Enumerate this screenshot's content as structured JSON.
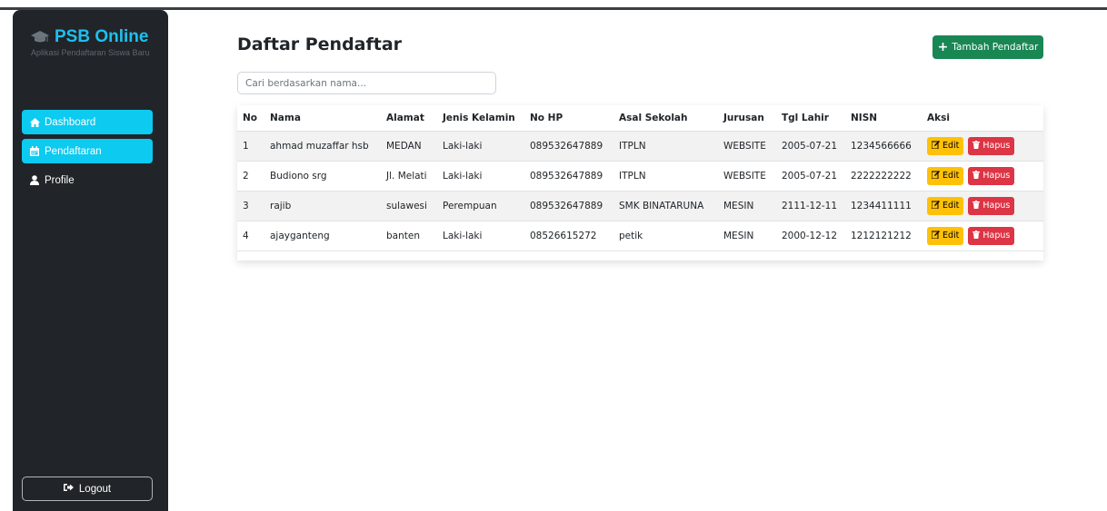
{
  "app": {
    "title": "PSB Online",
    "subtitle": "Aplikasi Pendaftaran Siswa Baru"
  },
  "sidebar": {
    "items": [
      {
        "label": "Dashboard",
        "icon": "home-icon",
        "active": true
      },
      {
        "label": "Pendaftaran",
        "icon": "calendar-icon",
        "active": true
      },
      {
        "label": "Profile",
        "icon": "user-icon",
        "active": false
      }
    ],
    "logout_label": "Logout"
  },
  "main": {
    "title": "Daftar Pendaftar",
    "add_button_label": "Tambah Pendaftar",
    "search_placeholder": "Cari berdasarkan nama...",
    "table": {
      "headers": [
        "No",
        "Nama",
        "Alamat",
        "Jenis Kelamin",
        "No HP",
        "Asal Sekolah",
        "Jurusan",
        "Tgl Lahir",
        "NISN",
        "Aksi"
      ],
      "rows": [
        [
          "1",
          "ahmad muzaffar hsb",
          "MEDAN",
          "Laki-laki",
          "089532647889",
          "ITPLN",
          "WEBSITE",
          "2005-07-21",
          "1234566666"
        ],
        [
          "2",
          "Budiono srg",
          "Jl. Melati",
          "Laki-laki",
          "089532647889",
          "ITPLN",
          "WEBSITE",
          "2005-07-21",
          "2222222222"
        ],
        [
          "3",
          "rajib",
          "sulawesi",
          "Perempuan",
          "089532647889",
          "SMK BINATARUNA",
          "MESIN",
          "2111-12-11",
          "1234411111"
        ],
        [
          "4",
          "ajayganteng",
          "banten",
          "Laki-laki",
          "08526615272",
          "petik",
          "MESIN",
          "2000-12-12",
          "1212121212"
        ]
      ],
      "edit_label": "Edit",
      "delete_label": "Hapus"
    }
  },
  "colors": {
    "sidebar_bg": "#212529",
    "accent": "#0dcaf0",
    "brand": "#1ec0ef",
    "add": "#198754",
    "edit": "#ffc107",
    "delete": "#dc3545"
  }
}
